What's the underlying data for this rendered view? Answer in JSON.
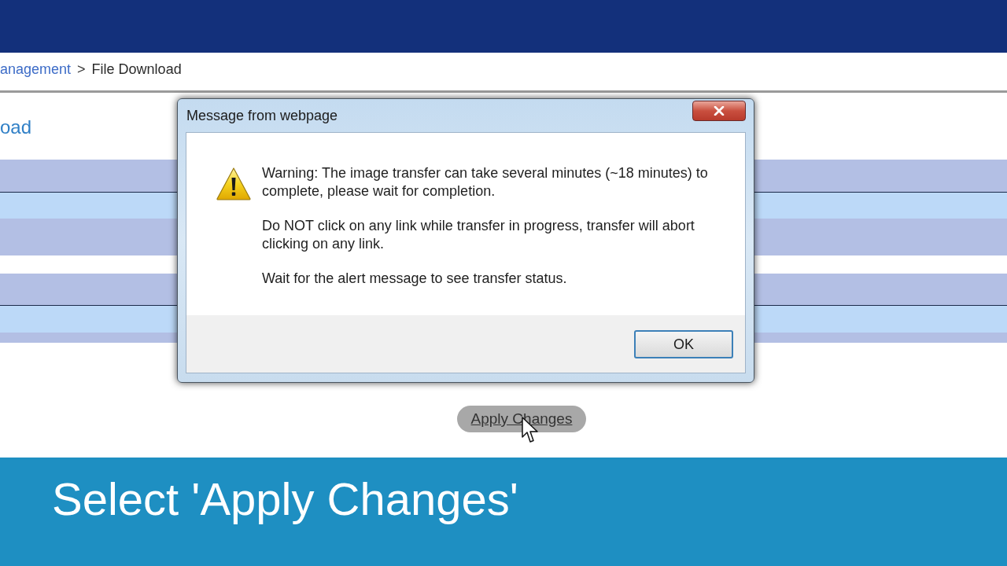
{
  "breadcrumb": [
    {
      "kind": "link",
      "label": "anagement"
    },
    {
      "kind": "separator",
      "label": ">"
    },
    {
      "kind": "current",
      "label": "File Download"
    }
  ],
  "page_heading": "oad",
  "dialog": {
    "title": "Message from webpage",
    "paragraphs": [
      "Warning: The image transfer can take several minutes (~18 minutes) to complete, please wait for completion.",
      "Do NOT click on any link while transfer in progress, transfer will abort clicking on any link.",
      "Wait for the alert message to see transfer status."
    ],
    "buttons": [
      {
        "label": "OK",
        "focused": true
      }
    ]
  },
  "apply_button": {
    "label": "Apply Changes"
  },
  "caption": "Select 'Apply Changes'"
}
